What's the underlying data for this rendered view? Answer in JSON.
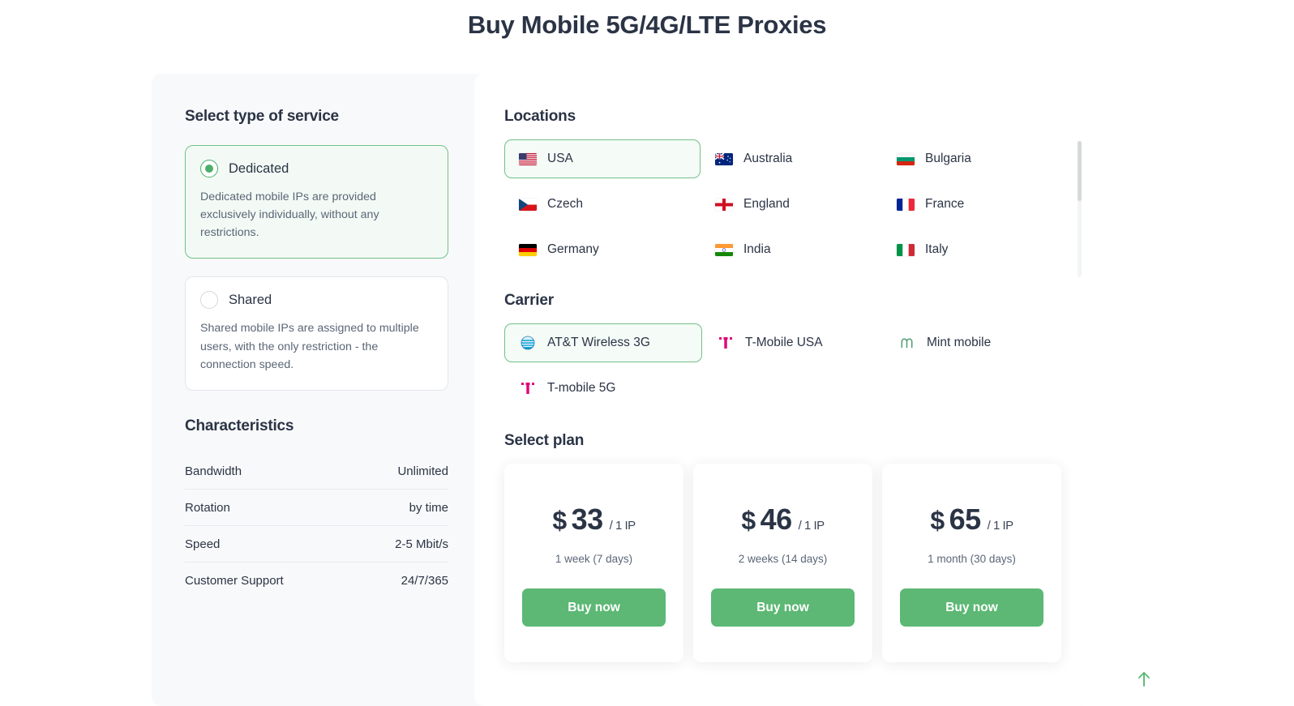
{
  "page": {
    "title": "Buy Mobile 5G/4G/LTE Proxies"
  },
  "service": {
    "heading": "Select type of service",
    "options": [
      {
        "name": "Dedicated",
        "description": "Dedicated mobile IPs are provided exclusively individually, without any restrictions.",
        "selected": true
      },
      {
        "name": "Shared",
        "description": "Shared mobile IPs are assigned to multiple users, with the only restriction - the connection speed.",
        "selected": false
      }
    ]
  },
  "characteristics": {
    "heading": "Characteristics",
    "rows": [
      {
        "key": "Bandwidth",
        "value": "Unlimited"
      },
      {
        "key": "Rotation",
        "value": "by time"
      },
      {
        "key": "Speed",
        "value": "2-5 Mbit/s"
      },
      {
        "key": "Customer Support",
        "value": "24/7/365"
      }
    ]
  },
  "locations": {
    "heading": "Locations",
    "items": [
      {
        "label": "USA",
        "icon": "flag-usa",
        "selected": true
      },
      {
        "label": "Australia",
        "icon": "flag-australia",
        "selected": false
      },
      {
        "label": "Bulgaria",
        "icon": "flag-bulgaria",
        "selected": false
      },
      {
        "label": "Czech",
        "icon": "flag-czech",
        "selected": false
      },
      {
        "label": "England",
        "icon": "flag-england",
        "selected": false
      },
      {
        "label": "France",
        "icon": "flag-france",
        "selected": false
      },
      {
        "label": "Germany",
        "icon": "flag-germany",
        "selected": false
      },
      {
        "label": "India",
        "icon": "flag-india",
        "selected": false
      },
      {
        "label": "Italy",
        "icon": "flag-italy",
        "selected": false
      }
    ]
  },
  "carrier": {
    "heading": "Carrier",
    "items": [
      {
        "label": "AT&T Wireless 3G",
        "icon": "att-logo",
        "selected": true
      },
      {
        "label": "T-Mobile USA",
        "icon": "tmobile-logo",
        "selected": false
      },
      {
        "label": "Mint mobile",
        "icon": "mint-logo",
        "selected": false
      },
      {
        "label": "T-mobile 5G",
        "icon": "tmobile-logo",
        "selected": false
      }
    ]
  },
  "plans": {
    "heading": "Select plan",
    "buy_label": "Buy now",
    "items": [
      {
        "currency": "$",
        "amount": "33",
        "unit": "/ 1 IP",
        "period": "1 week (7 days)"
      },
      {
        "currency": "$",
        "amount": "46",
        "unit": "/ 1 IP",
        "period": "2 weeks (14 days)"
      },
      {
        "currency": "$",
        "amount": "65",
        "unit": "/ 1 IP",
        "period": "1 month (30 days)"
      }
    ]
  },
  "colors": {
    "accent_green": "#5cb874",
    "selected_border": "#73c088",
    "selected_bg": "#f5fbf7",
    "text_dark": "#2b3445",
    "panel_bg": "#f8f9fa"
  }
}
